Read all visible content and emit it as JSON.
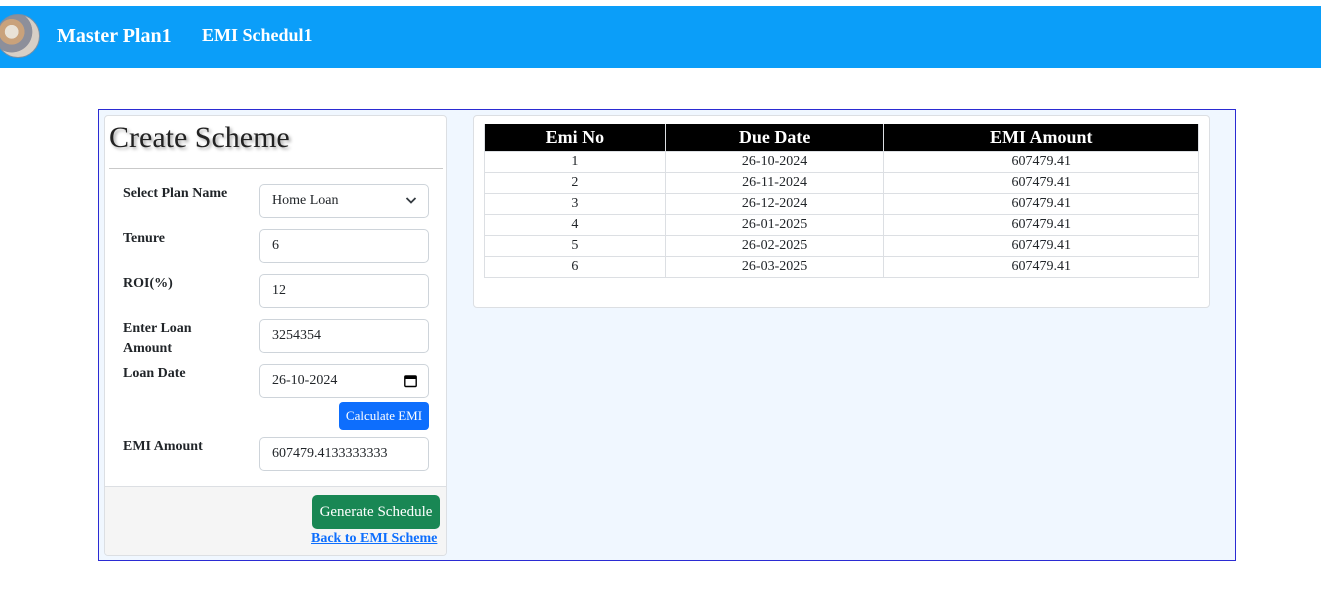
{
  "navbar": {
    "brand": "Master Plan1",
    "link": "EMI Schedul1"
  },
  "form": {
    "title": "Create Scheme",
    "plan_label": "Select Plan Name",
    "plan_value": "Home Loan",
    "tenure_label": "Tenure",
    "tenure_value": "6",
    "roi_label": "ROI(%)",
    "roi_value": "12",
    "amount_label": "Enter Loan Amount",
    "amount_value": "3254354",
    "date_label": "Loan Date",
    "date_value": "26-10-2024",
    "calc_button": "Calculate EMI",
    "emi_label": "EMI Amount",
    "emi_value": "607479.4133333333",
    "generate_button": "Generate Schedule",
    "back_link": "Back to EMI Scheme"
  },
  "schedule": {
    "headers": [
      "Emi No",
      "Due Date",
      "EMI Amount"
    ],
    "rows": [
      [
        "1",
        "26-10-2024",
        "607479.41"
      ],
      [
        "2",
        "26-11-2024",
        "607479.41"
      ],
      [
        "3",
        "26-12-2024",
        "607479.41"
      ],
      [
        "4",
        "26-01-2025",
        "607479.41"
      ],
      [
        "5",
        "26-02-2025",
        "607479.41"
      ],
      [
        "6",
        "26-03-2025",
        "607479.41"
      ]
    ]
  },
  "colors": {
    "navbar": "#0b9ef9",
    "primary_button": "#0d6efd",
    "success_button": "#198754",
    "panel_border": "#2b2bd3"
  }
}
